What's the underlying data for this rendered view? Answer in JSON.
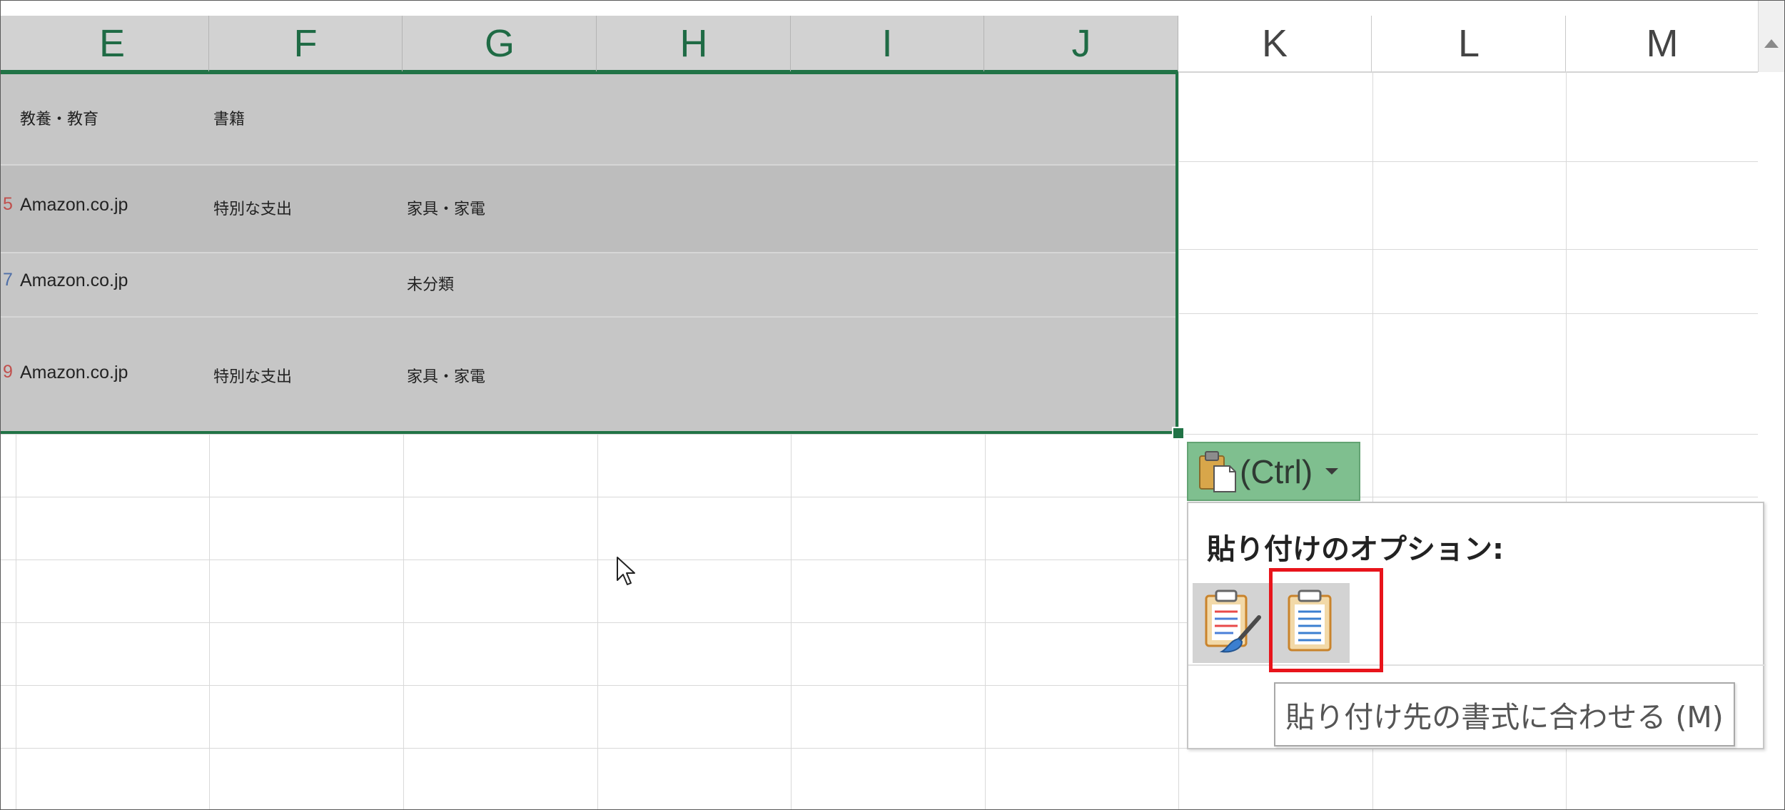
{
  "spreadsheet": {
    "columns": [
      "E",
      "F",
      "G",
      "H",
      "I",
      "J",
      "K",
      "L",
      "M"
    ],
    "selected_column_count": 6,
    "rows": [
      {
        "num": "",
        "num_color": "",
        "col_e": "教養・教育",
        "col_f": "書籍",
        "col_g": ""
      },
      {
        "num": "5",
        "num_color": "#c0504d",
        "col_e": "Amazon.co.jp",
        "col_f": "特別な支出",
        "col_g": "家具・家電"
      },
      {
        "num": "7",
        "num_color": "#4f6fa8",
        "col_e": "Amazon.co.jp",
        "col_f": "",
        "col_g": "未分類"
      },
      {
        "num": "9",
        "num_color": "#c0504d",
        "col_e": "Amazon.co.jp",
        "col_f": "特別な支出",
        "col_g": "家具・家電"
      }
    ]
  },
  "paste_button": {
    "label": "(Ctrl)",
    "icon": "clipboard-icon",
    "dropdown_icon": "chevron-down-icon"
  },
  "paste_menu": {
    "title": "貼り付けのオプション:",
    "options": [
      {
        "icon": "keep-source-formatting-icon"
      },
      {
        "icon": "match-destination-formatting-icon"
      }
    ],
    "tooltip": "貼り付け先の書式に合わせる (M)"
  },
  "colors": {
    "selection_border": "#217346",
    "highlight_box": "#e8141b",
    "paste_button_bg": "#7fbf8f"
  }
}
